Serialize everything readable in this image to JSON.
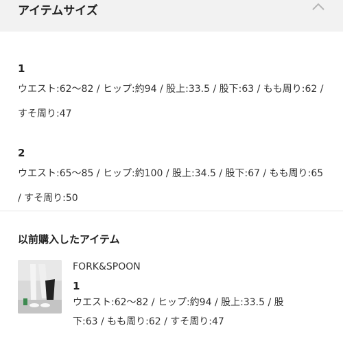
{
  "header": {
    "title": "アイテムサイズ",
    "toggle_icon": "chevron-up-icon"
  },
  "sizes": [
    {
      "number": "1",
      "detail": "ウエスト:62〜82 / ヒップ:約94 / 股上:33.5 / 股下:63 / もも周り:62 / すそ周り:47"
    },
    {
      "number": "2",
      "detail": "ウエスト:65〜85 / ヒップ:約100 / 股上:34.5 / 股下:67 / もも周り:65 / すそ周り:50"
    }
  ],
  "previous": {
    "heading": "以前購入したアイテム",
    "item": {
      "brand": "FORK&SPOON",
      "size": "1",
      "detail": "ウエスト:62〜82 / ヒップ:約94 / 股上:33.5 / 股下:63 / もも周り:62 / すそ周り:47"
    }
  }
}
